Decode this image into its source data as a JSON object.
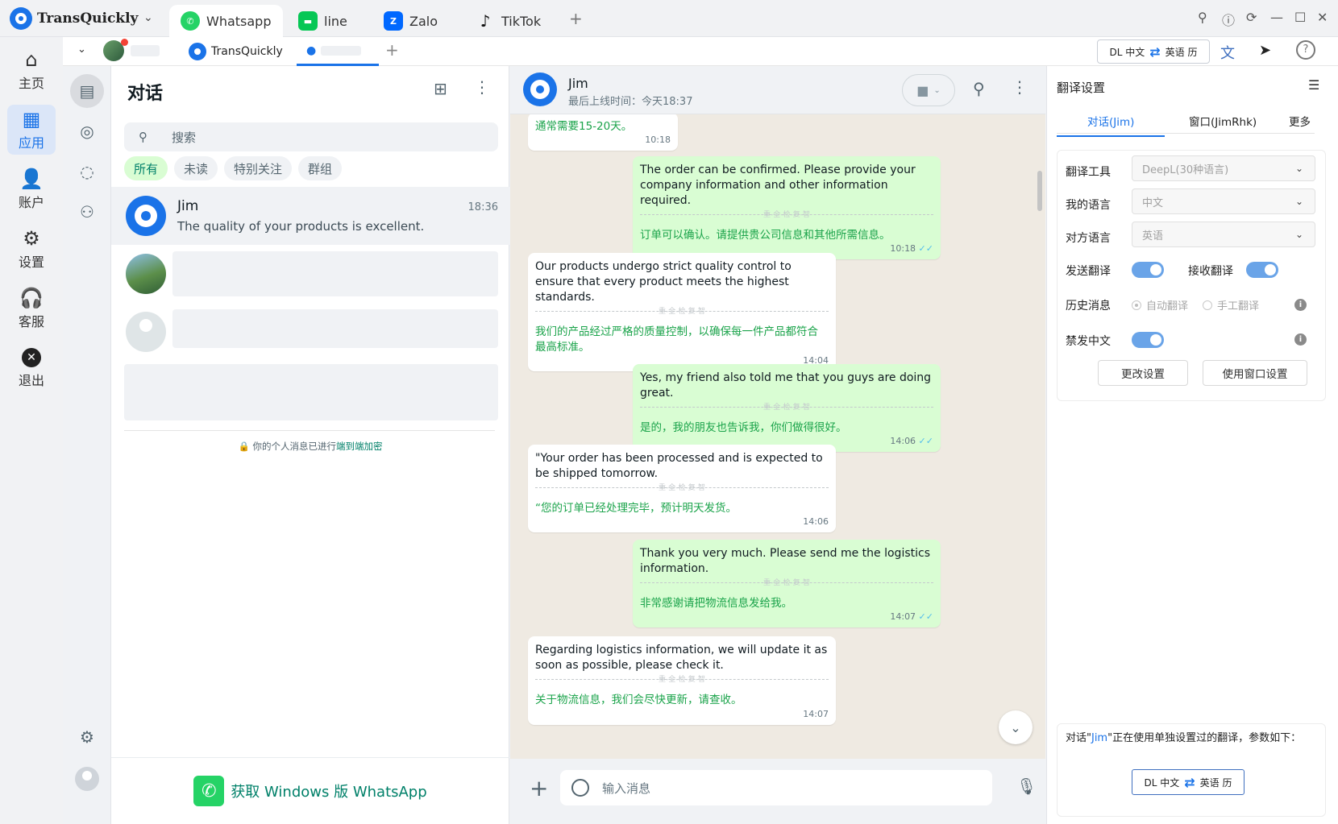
{
  "app": {
    "name": "TransQuickly"
  },
  "app_tabs": [
    {
      "label": "Whatsapp",
      "icon": "whatsapp-icon",
      "active": true
    },
    {
      "label": "line",
      "icon": "line-icon"
    },
    {
      "label": "Zalo",
      "icon": "zalo-icon"
    },
    {
      "label": "TikTok",
      "icon": "tiktok-icon"
    }
  ],
  "sub_tabs": {
    "account_tab": "TransQuickly"
  },
  "lang_pill": {
    "left": "DL 中文",
    "right": "英语 历"
  },
  "left_nav": [
    {
      "label": "主页",
      "icon": "home-icon"
    },
    {
      "label": "应用",
      "icon": "apps-icon",
      "active": true
    },
    {
      "label": "账户",
      "icon": "account-icon"
    },
    {
      "label": "设置",
      "icon": "settings-icon"
    },
    {
      "label": "客服",
      "icon": "headset-icon"
    },
    {
      "label": "退出",
      "icon": "exit-icon"
    }
  ],
  "chat_list": {
    "title": "对话",
    "search_placeholder": "搜索",
    "filters": [
      "所有",
      "未读",
      "特别关注",
      "群组"
    ],
    "chats": [
      {
        "name": "Jim",
        "time": "18:36",
        "preview": "The quality of your products is excellent."
      }
    ],
    "encrypt_prefix": "你的个人消息已进行",
    "encrypt_link": "端到端加密",
    "footer": "获取 Windows 版 WhatsApp"
  },
  "conversation": {
    "name": "Jim",
    "status": "最后上线时间：今天18:37",
    "divider_label": "重-全-检-复-智",
    "input_placeholder": "输入消息",
    "messages": [
      {
        "dir": "in",
        "text": "",
        "trans": "通常需要15-20天。",
        "time": "10:18"
      },
      {
        "dir": "out",
        "text": "The order can be confirmed. Please provide your company information and other information required.",
        "trans": "订单可以确认。请提供贵公司信息和其他所需信息。",
        "time": "10:18"
      },
      {
        "dir": "in",
        "text": "Our products undergo strict quality control to ensure that every product meets the highest standards.",
        "trans": "我们的产品经过严格的质量控制，以确保每一件产品都符合最高标准。",
        "time": "14:04"
      },
      {
        "dir": "out",
        "text": "Yes, my friend also told me that you guys are doing great.",
        "trans": "是的，我的朋友也告诉我，你们做得很好。",
        "time": "14:06"
      },
      {
        "dir": "in",
        "text": "\"Your order has been processed and is expected to be shipped tomorrow.",
        "trans": "“您的订单已经处理完毕，预计明天发货。",
        "time": "14:06"
      },
      {
        "dir": "out",
        "text": "Thank you very much. Please send me the logistics information.",
        "trans": "非常感谢请把物流信息发给我。",
        "time": "14:07"
      },
      {
        "dir": "in",
        "text": "Regarding logistics information, we will update it as soon as possible, please check it.",
        "trans": "关于物流信息，我们会尽快更新，请查收。",
        "time": "14:07"
      }
    ]
  },
  "translate_panel": {
    "title": "翻译设置",
    "tabs": [
      "对话(Jim)",
      "窗口(JimRhk)",
      "更多"
    ],
    "tool_label": "翻译工具",
    "tool_value": "DeepL(30种语言)",
    "my_lang_label": "我的语言",
    "my_lang_value": "中文",
    "their_lang_label": "对方语言",
    "their_lang_value": "英语",
    "send_label": "发送翻译",
    "recv_label": "接收翻译",
    "history_label": "历史消息",
    "auto_label": "自动翻译",
    "manual_label": "手工翻译",
    "ban_cn_label": "禁发中文",
    "btn_change": "更改设置",
    "btn_window": "使用窗口设置",
    "note_prefix": "对话\"",
    "note_name": "Jim",
    "note_suffix": "\"正在使用单独设置过的翻译，参数如下：",
    "toggles": {
      "send": true,
      "receive": true,
      "ban_chinese": true
    }
  }
}
